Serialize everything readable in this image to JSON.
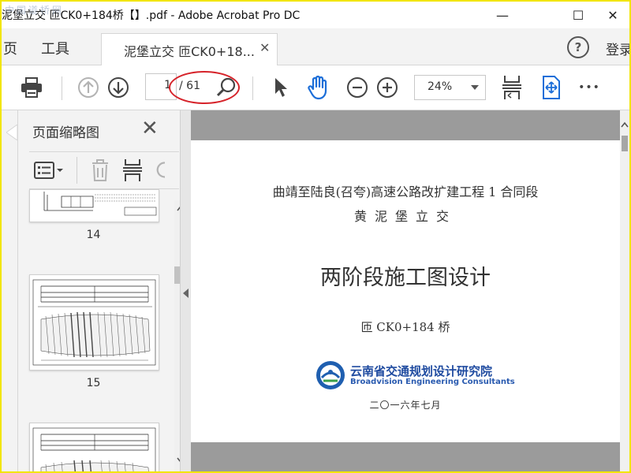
{
  "window": {
    "title": "泥堡立交 匝CK0+184桥【】.pdf - Adobe Acrobat Pro DC",
    "watermark": "中国道桥网",
    "min_glyph": "—",
    "max_glyph": "☐",
    "close_glyph": "✕"
  },
  "menu": {
    "home": "页",
    "tools": "工具",
    "doc_tab": "泥堡立交 匝CK0+18...",
    "tab_close": "✕",
    "help": "?",
    "login": "登录"
  },
  "toolbar": {
    "page_current": "1",
    "page_total": "/ 61",
    "zoom": "24%",
    "more": "•••"
  },
  "thumbnails": {
    "title": "页面缩略图",
    "close": "✕",
    "pages": [
      "14",
      "15"
    ]
  },
  "document": {
    "line1": "曲靖至陆良(召夸)高速公路改扩建工程 1 合同段",
    "line2": "黄泥堡立交",
    "main_title": "两阶段施工图设计",
    "bridge": "匝 CK0+184 桥",
    "org_cn": "云南省交通规划设计研究院",
    "org_en": "Broadvision Engineering Consultants",
    "date": "二〇一六年七月"
  },
  "colors": {
    "border": "#f2e500",
    "highlight": "#d6232a",
    "acrobat_blue": "#1c6ed8",
    "org_blue": "#1f4ba0",
    "doc_bg": "#9b9b9b"
  }
}
